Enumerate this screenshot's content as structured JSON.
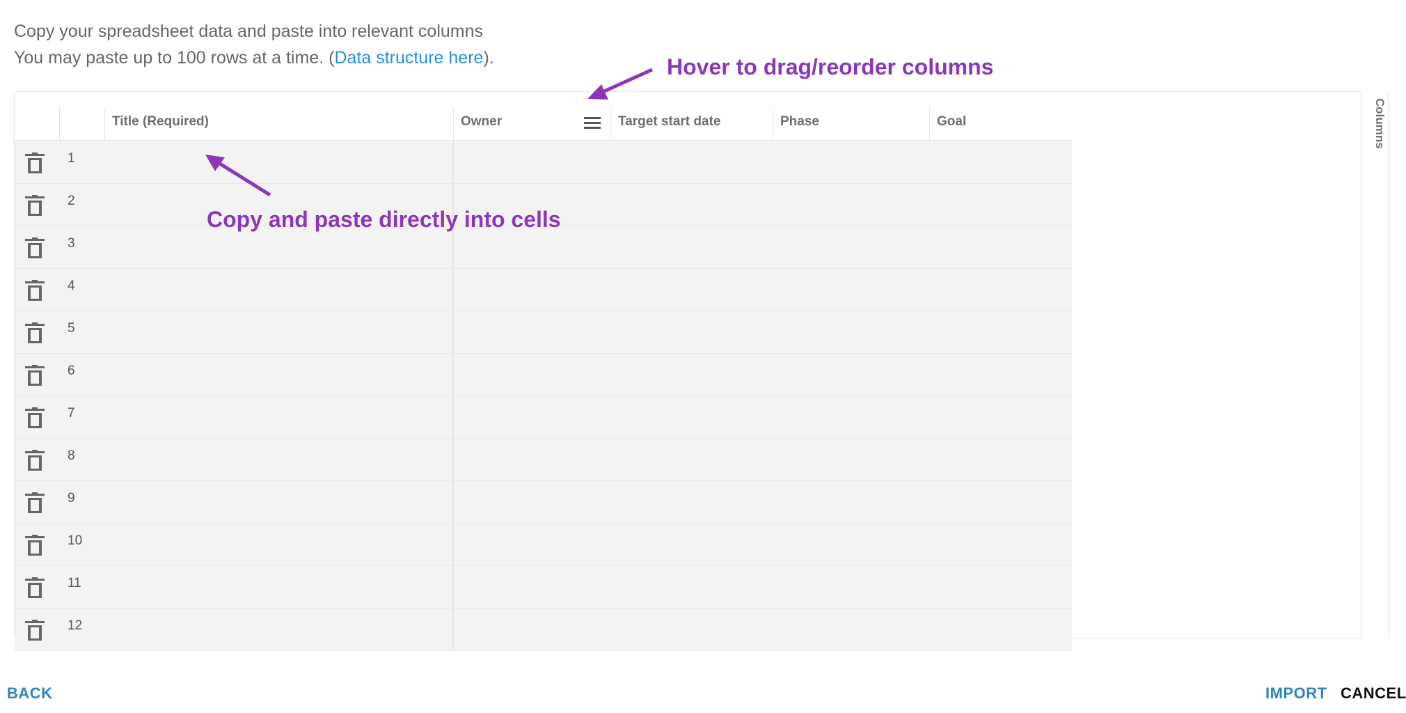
{
  "intro": {
    "line1": "Copy your spreadsheet data and paste into relevant columns",
    "line2_prefix": "You may paste up to 100 rows at a time.  (",
    "link": "Data structure here",
    "line2_suffix": ")."
  },
  "columns": [
    {
      "label": "Title (Required)"
    },
    {
      "label": "Owner"
    },
    {
      "label": "Target start date"
    },
    {
      "label": "Phase"
    },
    {
      "label": "Goal"
    }
  ],
  "rows": [
    "1",
    "2",
    "3",
    "4",
    "5",
    "6",
    "7",
    "8",
    "9",
    "10",
    "11",
    "12"
  ],
  "side_panel": {
    "label": "Columns"
  },
  "annotations": {
    "drag": "Hover to drag/reorder columns",
    "paste": "Copy and paste directly into cells"
  },
  "footer": {
    "back": "BACK",
    "import": "IMPORT",
    "cancel": "CANCEL"
  },
  "colors": {
    "accent": "#2f86b8",
    "link": "#2b8fd6",
    "annotation": "#8c37b8"
  },
  "icons": {
    "row_delete": "trash-icon",
    "column_menu": "menu-icon"
  }
}
